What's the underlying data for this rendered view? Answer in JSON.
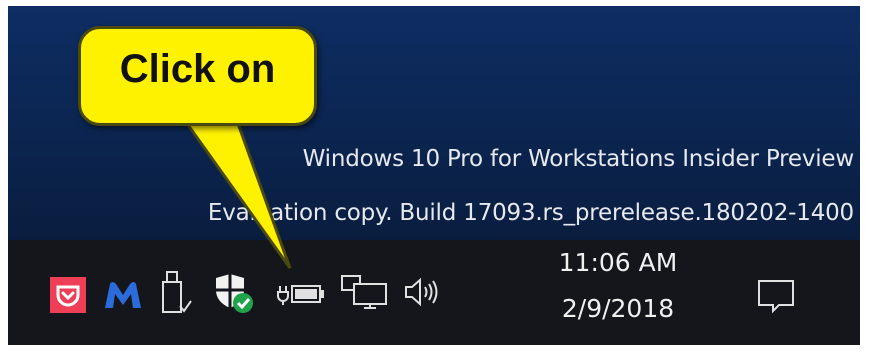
{
  "callout": {
    "text": "Click on"
  },
  "watermark": {
    "line1": "Windows 10 Pro for Workstations Insider Preview",
    "line2": "Evaluation copy. Build 17093.rs_prerelease.180202-1400"
  },
  "tray": {
    "icons": [
      "pocket-icon",
      "malwarebytes-icon",
      "usb-drive-icon",
      "windows-defender-security-icon",
      "power-battery-icon",
      "network-icon",
      "volume-icon"
    ],
    "clock": {
      "time": "11:06 AM",
      "date": "2/9/2018"
    },
    "action_center": "action-center-icon"
  },
  "colors": {
    "callout_fill": "#fff200",
    "desktop": "#0b2550",
    "taskbar": "#14161c",
    "pocket_red": "#ef3f56",
    "malwarebytes_blue": "#2b6bdc",
    "defender_green": "#1fa34a"
  }
}
